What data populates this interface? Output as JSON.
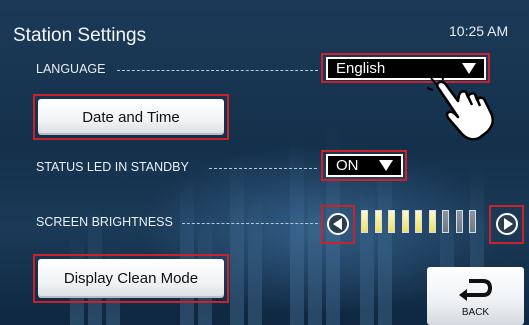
{
  "header": {
    "title": "Station Settings",
    "time": "10:25 AM"
  },
  "language": {
    "label": "LANGUAGE",
    "value": "English"
  },
  "date_time": {
    "button_label": "Date and Time"
  },
  "status_led": {
    "label": "STATUS LED IN STANDBY",
    "value": "ON"
  },
  "screen_brightness": {
    "label": "SCREEN BRIGHTNESS",
    "level": 6,
    "max": 9
  },
  "display_clean": {
    "button_label": "Display Clean Mode"
  },
  "back": {
    "label": "BACK"
  },
  "icons": {
    "dropdown": "triangle-down-icon",
    "decrease": "arrow-left-icon",
    "increase": "arrow-right-icon",
    "back": "return-arrow-icon",
    "pointer": "hand-pointer-icon"
  },
  "colors": {
    "highlight": "#c9222b",
    "level_on": "#f0e05a",
    "level_off": "#7c8793"
  }
}
